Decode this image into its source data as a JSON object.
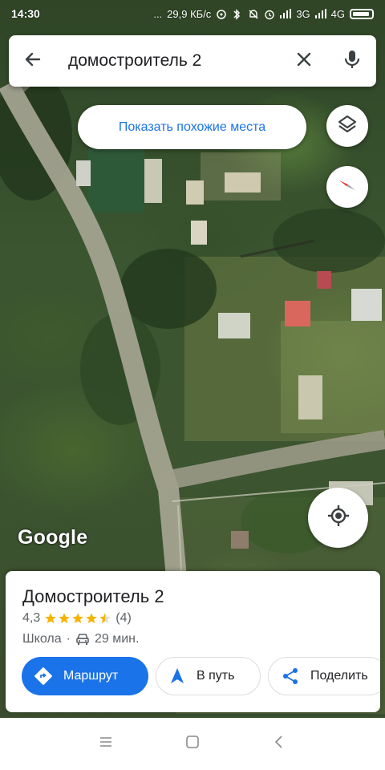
{
  "status_bar": {
    "time": "14:30",
    "dots": "...",
    "net_speed": "29,9 КБ/с",
    "network_3g": "3G",
    "network_4g": "4G"
  },
  "search": {
    "query": "домостроитель 2",
    "back_icon": "arrow-back-icon",
    "clear_icon": "close-icon",
    "voice_icon": "microphone-icon"
  },
  "chip": {
    "label": "Показать похожие места"
  },
  "map": {
    "logo_text": "Google",
    "layers_icon": "layers-icon",
    "compass_icon": "compass-icon",
    "locate_icon": "my-location-icon"
  },
  "place": {
    "name": "Домостроитель 2",
    "rating": "4,3",
    "stars_value": 4.3,
    "reviews": "(4)",
    "category": "Школа",
    "separator": "·",
    "drive_time": "29 мин."
  },
  "actions": {
    "route": "Маршрут",
    "go": "В путь",
    "share": "Поделить"
  },
  "colors": {
    "accent": "#1a73e8",
    "star": "#f4b400",
    "compass_red": "#e53935"
  }
}
